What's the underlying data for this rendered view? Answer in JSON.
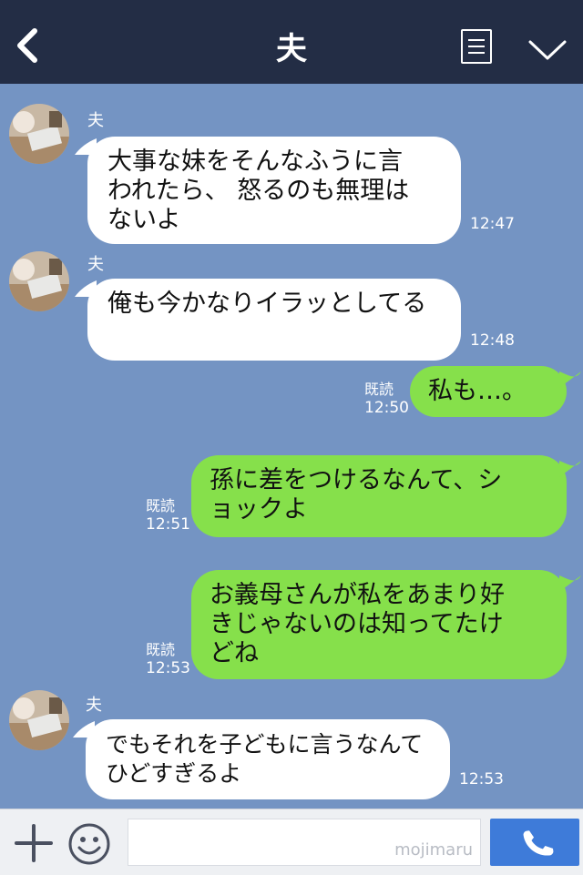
{
  "header": {
    "title": "夫",
    "back_icon": "chevron-left-icon",
    "menu_icon": "menu-icon",
    "collapse_icon": "chevron-down-icon"
  },
  "messages": [
    {
      "side": "in",
      "sender": "夫",
      "lines": [
        "大事な妹をそんなふうに言",
        "われたら、 怒るのも無理は",
        "ないよ"
      ],
      "time": "12:47"
    },
    {
      "side": "in",
      "sender": "夫",
      "lines": [
        "俺も今かなりイラッとしてる"
      ],
      "time": "12:48"
    },
    {
      "side": "out",
      "read": "既読",
      "lines": [
        "私も…。"
      ],
      "time": "12:50"
    },
    {
      "side": "out",
      "read": "既読",
      "lines": [
        "孫に差をつけるなんて、シ",
        "ョックよ"
      ],
      "time": "12:51"
    },
    {
      "side": "out",
      "read": "既読",
      "lines": [
        "お義母さんが私をあまり好",
        "きじゃないのは知ってたけ",
        "どね"
      ],
      "time": "12:53"
    },
    {
      "side": "in",
      "sender": "夫",
      "lines": [
        "でもそれを子どもに言うなんて",
        "ひどすぎるよ"
      ],
      "time": "12:53"
    }
  ],
  "input_bar": {
    "plus_icon": "plus-icon",
    "emoji_icon": "smiley-icon",
    "watermark": "mojimaru",
    "call_icon": "phone-icon"
  },
  "colors": {
    "header_bg": "#232d45",
    "chat_bg": "#7494c3",
    "outgoing_bubble": "#86e04b",
    "incoming_bubble": "#ffffff",
    "call_button": "#3e7bd9"
  }
}
